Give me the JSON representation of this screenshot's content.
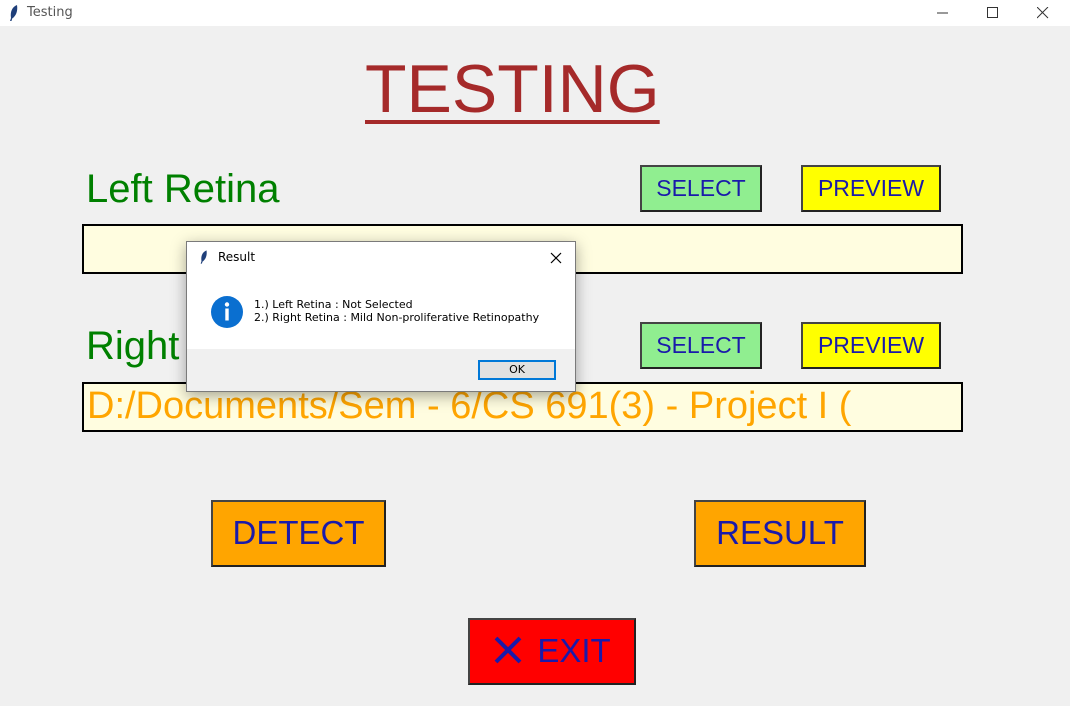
{
  "window": {
    "title": "Testing"
  },
  "page": {
    "heading": "TESTING",
    "left": {
      "label": "Left Retina",
      "select_label": "SELECT",
      "preview_label": "PREVIEW",
      "path_value": ""
    },
    "right": {
      "label": "Right Retina",
      "select_label": "SELECT",
      "preview_label": "PREVIEW",
      "path_value": "D:/Documents/Sem - 6/CS 691(3) - Project I ("
    },
    "detect_label": "DETECT",
    "result_label": "RESULT",
    "exit_label": "EXIT"
  },
  "dialog": {
    "title": "Result",
    "line1": "1.) Left Retina : Not Selected",
    "line2": "2.) Right Retina : Mild Non-proliferative Retinopathy",
    "ok_label": "OK"
  },
  "icons": {
    "app": "feather-icon",
    "info": "info-icon",
    "exit": "close-x-icon"
  },
  "colors": {
    "heading": "#a52a2a",
    "label": "#008000",
    "select_bg": "#90ee90",
    "preview_bg": "#ffff00",
    "action_bg": "#ffa500",
    "exit_bg": "#ff0000",
    "button_text": "#1a1aaa",
    "path_text": "#ffa500",
    "path_bg": "#fffde0"
  }
}
